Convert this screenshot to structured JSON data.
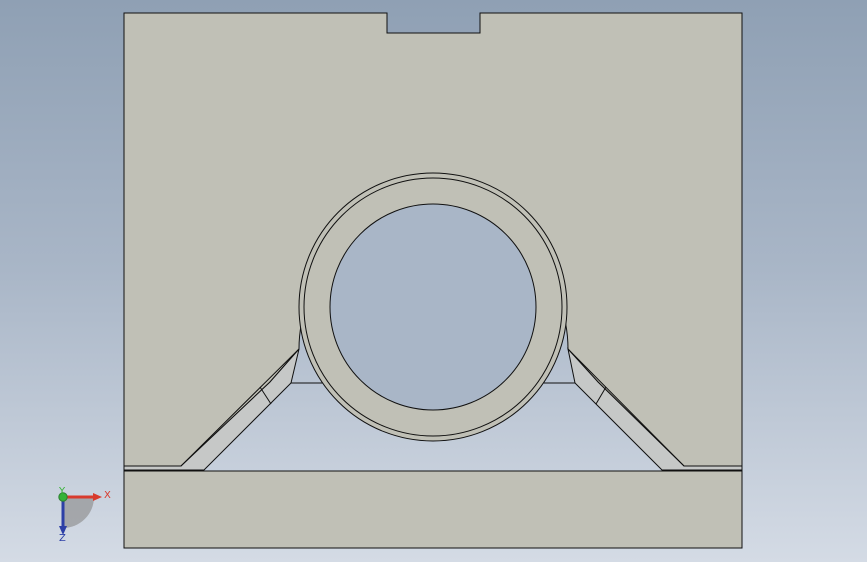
{
  "view": {
    "background_top": "#8fa0b4",
    "background_mid": "#a9b6c7",
    "background_bottom": "#d4dbe5",
    "part_face_color": "#c0c0b6",
    "edge_color": "#101010",
    "hole_color": "#a9b6c7"
  },
  "triad": {
    "x_label": "X",
    "y_label": "Y",
    "z_label": "Z",
    "x_color": "#d83a2d",
    "y_color": "#36b338",
    "z_color": "#2c3fa6"
  }
}
